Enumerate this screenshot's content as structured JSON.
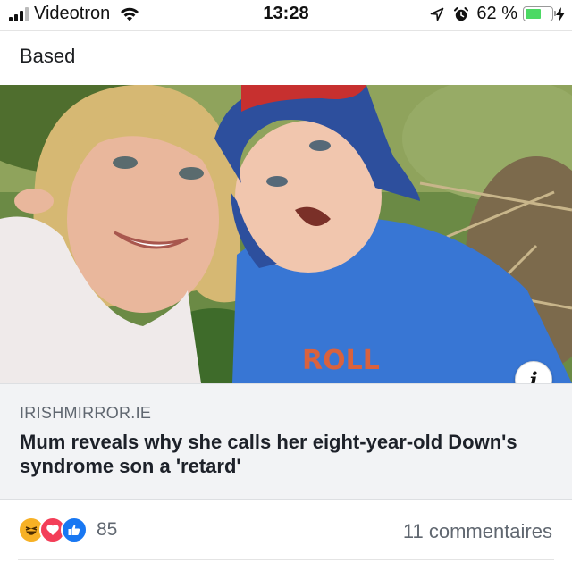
{
  "status_bar": {
    "carrier": "Videotron",
    "time": "13:28",
    "battery_percent": "62 %",
    "battery_level": 0.62,
    "icons": [
      "signal-bars-icon",
      "wifi-icon",
      "location-arrow-icon",
      "alarm-icon",
      "battery-icon",
      "charging-bolt-icon"
    ]
  },
  "post": {
    "text": "Based"
  },
  "link_preview": {
    "image_alt": "Photo of a smiling blonde woman next to a young boy in a blue cap and blue t-shirt outdoors",
    "shirt_text": "ROLL",
    "domain": "IRISHMIRROR.IE",
    "title": "Mum reveals why she calls her eight-year-old Down's syndrome son a 'retard'",
    "info_icon_glyph": "i"
  },
  "footer": {
    "reactions": [
      "haha-icon",
      "love-icon",
      "like-icon"
    ],
    "reaction_count": "85",
    "comments_label": "11 commentaires"
  },
  "colors": {
    "like": "#1877f2",
    "love": "#f33e58",
    "haha": "#f7b125",
    "battery": "#4cd964",
    "meta_bg": "#f2f3f5",
    "secondary_text": "#606770"
  }
}
